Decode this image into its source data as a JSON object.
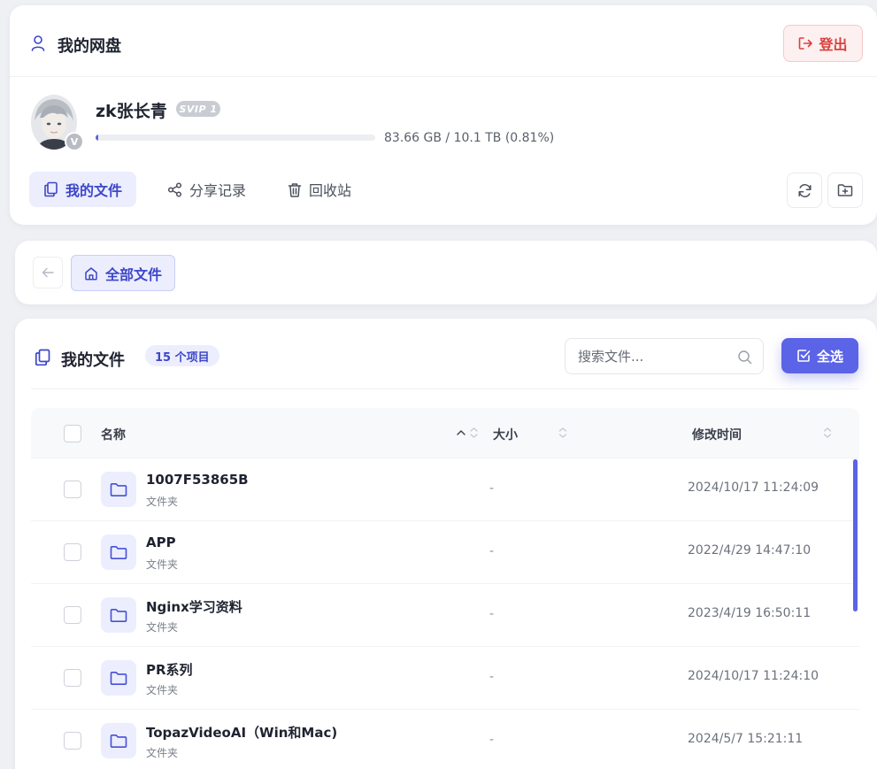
{
  "header": {
    "title": "我的网盘",
    "logout_label": "登出"
  },
  "user": {
    "name": "zk张长青",
    "level": "SVIP 1",
    "vip_badge": "V",
    "quota_text": "83.66 GB / 10.1 TB (0.81%)",
    "quota_used_fraction": 0.0081
  },
  "nav": {
    "tabs": [
      {
        "label": "我的文件",
        "active": true
      },
      {
        "label": "分享记录",
        "active": false
      },
      {
        "label": "回收站",
        "active": false
      }
    ]
  },
  "breadcrumb": {
    "root_label": "全部文件"
  },
  "files": {
    "title": "我的文件",
    "count_label": "15 个项目",
    "search_placeholder": "搜索文件...",
    "select_all_label": "全选",
    "columns": {
      "name": "名称",
      "size": "大小",
      "modified": "修改时间"
    },
    "rows": [
      {
        "name": "1007F53865B",
        "type": "文件夹",
        "size": "-",
        "modified": "2024/10/17 11:24:09"
      },
      {
        "name": "APP",
        "type": "文件夹",
        "size": "-",
        "modified": "2022/4/29 14:47:10"
      },
      {
        "name": "Nginx学习资料",
        "type": "文件夹",
        "size": "-",
        "modified": "2023/4/19 16:50:11"
      },
      {
        "name": "PR系列",
        "type": "文件夹",
        "size": "-",
        "modified": "2024/10/17 11:24:10"
      },
      {
        "name": "TopazVideoAI（Win和Mac)",
        "type": "文件夹",
        "size": "-",
        "modified": "2024/5/7 15:21:11"
      }
    ]
  },
  "colors": {
    "accent": "#5b63e6",
    "accent_soft": "#eceefe",
    "danger": "#d9413f",
    "page_bg": "#eef0f4"
  },
  "icons": {
    "header": "user-icon",
    "logout": "logout-icon",
    "my_files": "files-icon",
    "share": "share-icon",
    "trash": "trash-icon",
    "refresh": "refresh-icon",
    "new_folder": "folder-plus-icon",
    "back": "arrow-left-icon",
    "home": "home-icon",
    "search": "search-icon",
    "select_all": "checkbox-checked-icon",
    "folder": "folder-icon"
  }
}
